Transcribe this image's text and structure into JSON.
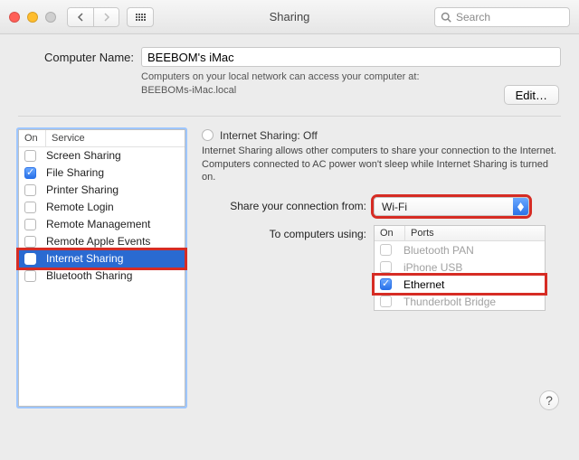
{
  "window": {
    "title": "Sharing"
  },
  "search": {
    "placeholder": "Search"
  },
  "computer_name": {
    "label": "Computer Name:",
    "value": "BEEBOM's iMac",
    "hint_line1": "Computers on your local network can access your computer at:",
    "hint_line2": "BEEBOMs-iMac.local",
    "edit_label": "Edit…"
  },
  "service_headers": {
    "on": "On",
    "service": "Service"
  },
  "services": [
    {
      "label": "Screen Sharing",
      "checked": false,
      "selected": false,
      "highlight": false
    },
    {
      "label": "File Sharing",
      "checked": true,
      "selected": false,
      "highlight": false
    },
    {
      "label": "Printer Sharing",
      "checked": false,
      "selected": false,
      "highlight": false
    },
    {
      "label": "Remote Login",
      "checked": false,
      "selected": false,
      "highlight": false
    },
    {
      "label": "Remote Management",
      "checked": false,
      "selected": false,
      "highlight": false
    },
    {
      "label": "Remote Apple Events",
      "checked": false,
      "selected": false,
      "highlight": false
    },
    {
      "label": "Internet Sharing",
      "checked": false,
      "selected": true,
      "highlight": true
    },
    {
      "label": "Bluetooth Sharing",
      "checked": false,
      "selected": false,
      "highlight": false
    }
  ],
  "internet_sharing": {
    "title": "Internet Sharing: Off",
    "desc": "Internet Sharing allows other computers to share your connection to the Internet. Computers connected to AC power won't sleep while Internet Sharing is turned on.",
    "from_label": "Share your connection from:",
    "from_value": "Wi-Fi",
    "to_label": "To computers using:"
  },
  "port_headers": {
    "on": "On",
    "ports": "Ports"
  },
  "ports": [
    {
      "label": "Bluetooth PAN",
      "checked": false,
      "highlight": false
    },
    {
      "label": "iPhone USB",
      "checked": false,
      "highlight": false
    },
    {
      "label": "Ethernet",
      "checked": true,
      "highlight": true
    },
    {
      "label": "Thunderbolt Bridge",
      "checked": false,
      "highlight": false
    }
  ],
  "colors": {
    "highlight": "#d62c24",
    "selection": "#2a6ad1",
    "accent": "#2a72e8"
  }
}
